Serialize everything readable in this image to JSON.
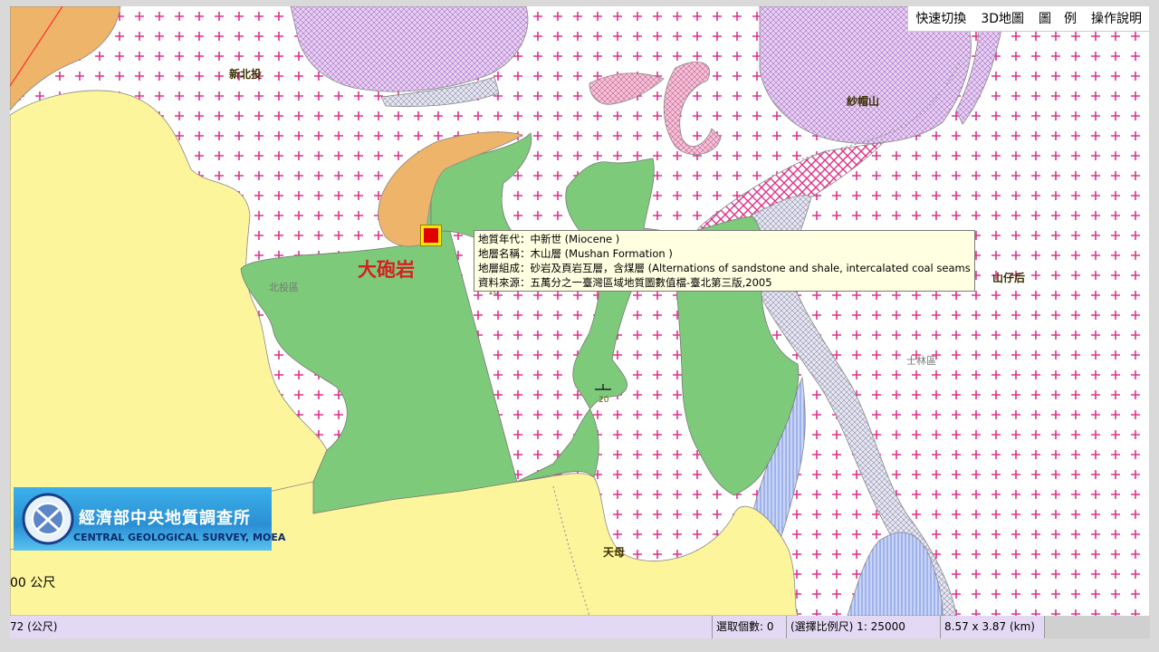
{
  "toolbar": {
    "items": [
      "快速切換",
      "3D地圖",
      "圖　例",
      "操作說明"
    ]
  },
  "places": {
    "xinbeitou": "新北投",
    "shamaoshan": "紗帽山",
    "shanzihou": "山仔后",
    "tianmu": "天母",
    "beitou_district": "北投區",
    "shilin_district": "士林區"
  },
  "feature_label": "大砲岩",
  "strike_dips": [
    "16",
    "20"
  ],
  "tooltip": {
    "lines": [
      "地質年代：中新世 (Miocene )",
      "地層名稱：木山層 (Mushan Formation )",
      "地層組成：砂岩及頁岩互層，含煤層 (Alternations of sandstone and shale, intercalated coal seams )",
      "資料來源：五萬分之一臺灣區域地質圖數值檔-臺北第三版,2005"
    ]
  },
  "logo": {
    "name_zh": "經濟部中央地質調查所",
    "name_en": "CENTRAL GEOLOGICAL SURVEY, MOEA"
  },
  "scale_text": "00 公尺",
  "status": {
    "distance": "72 (公尺)",
    "selected_count": "選取個數: 0",
    "scale": "(選擇比例尺) 1: 25000",
    "extent": "8.57 x 3.87 (km)"
  },
  "colors": {
    "miocene_green": "#7dcb7a",
    "alluvium_yellow": "#fdf59c",
    "orange_unit": "#eeb46a",
    "andesite_cross": "#e0308a",
    "lavender_unit": "#e8c7f0",
    "pink_unit": "#f4b8cf",
    "grey_unit": "#d8d8e8",
    "blue_unit": "#aebff0"
  }
}
